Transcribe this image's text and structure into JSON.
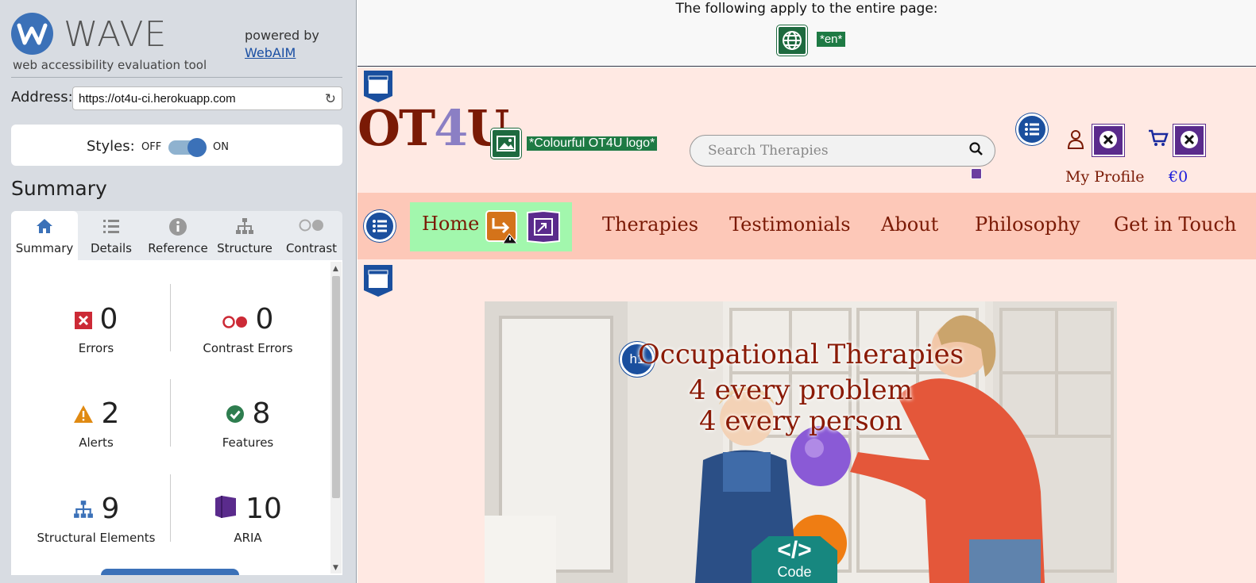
{
  "sidebar": {
    "logo_word": "WAVE",
    "logo_sub": "web accessibility evaluation tool",
    "powered_by": "powered by",
    "webaim_link": "WebAIM",
    "address_label": "Address:",
    "address_value": "https://ot4u-ci.herokuapp.com",
    "styles_label": "Styles:",
    "styles_off": "OFF",
    "styles_on": "ON",
    "summary_heading": "Summary",
    "tabs": [
      {
        "label": "Summary",
        "icon": "home-icon"
      },
      {
        "label": "Details",
        "icon": "list-icon"
      },
      {
        "label": "Reference",
        "icon": "info-icon"
      },
      {
        "label": "Structure",
        "icon": "structure-icon"
      },
      {
        "label": "Contrast",
        "icon": "contrast-icon"
      }
    ],
    "stats": [
      {
        "value": "0",
        "label": "Errors",
        "icon": "error-icon"
      },
      {
        "value": "0",
        "label": "Contrast Errors",
        "icon": "contrast-error-icon"
      },
      {
        "value": "2",
        "label": "Alerts",
        "icon": "alert-icon"
      },
      {
        "value": "8",
        "label": "Features",
        "icon": "feature-icon"
      },
      {
        "value": "9",
        "label": "Structural Elements",
        "icon": "structure-icon"
      },
      {
        "value": "10",
        "label": "ARIA",
        "icon": "aria-icon"
      }
    ]
  },
  "page": {
    "top_notice": "The following apply to the entire page:",
    "lang_tag": "*en*",
    "brand_pre": "OT",
    "brand_four": "4",
    "brand_post": "U",
    "logo_alt": "*Colourful OT4U logo*",
    "search_placeholder": "Search Therapies",
    "my_profile": "My Profile",
    "cart_total": "€0",
    "nav": {
      "home": "Home",
      "items": [
        "Therapies",
        "Testimonials",
        "About",
        "Philosophy",
        "Get in Touch"
      ]
    },
    "hero_lines": [
      "Occupational Therapies",
      "4 every problem",
      "4 every person"
    ],
    "h1_badge": "h1",
    "code_badge_tag": "</>",
    "code_badge_label": "Code"
  },
  "colors": {
    "wave_blue": "#3b71b8",
    "brand_red": "#7a1a05",
    "nav_bg": "#fdc8b8",
    "home_bg": "#a2f7ad",
    "page_bg": "#ffe9e3"
  }
}
